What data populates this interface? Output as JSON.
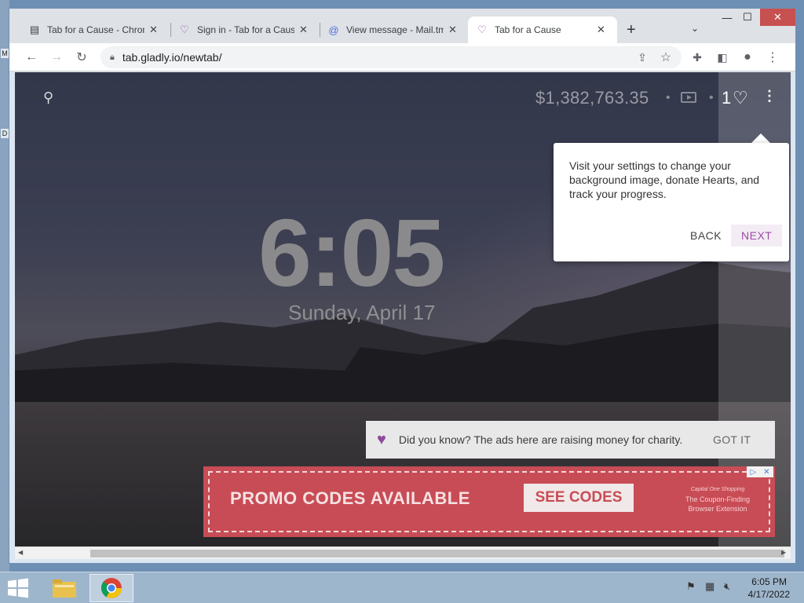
{
  "desktop": {
    "glyphs": [
      "M",
      "D"
    ]
  },
  "browser": {
    "tabs": [
      {
        "title": "Tab for a Cause - Chrom",
        "close": "✕"
      },
      {
        "title": "Sign in - Tab for a Caus",
        "close": "✕"
      },
      {
        "title": "View message - Mail.tm",
        "close": "✕"
      },
      {
        "title": "Tab for a Cause",
        "close": "✕"
      }
    ],
    "active_tab_index": 3,
    "new_tab_label": "+",
    "url": "tab.gladly.io/newtab/",
    "window_buttons": {
      "minimize": "—",
      "maximize": "☐",
      "close": "✕"
    }
  },
  "page": {
    "money_raised": "$1,382,763.35",
    "hearts": "1",
    "clock": "6:05",
    "date": "Sunday, April 17",
    "tooltip": {
      "text": "Visit your settings to change your background image, donate Hearts, and track your progress.",
      "back_label": "BACK",
      "next_label": "NEXT"
    },
    "notice": {
      "text": "Did you know? The ads here are raising money for charity.",
      "action": "GOT IT"
    },
    "ad": {
      "headline": "PROMO CODES AVAILABLE",
      "cta": "SEE CODES",
      "brand_line": "Capital One Shopping",
      "tagline": "The Coupon-Finding Browser Extension"
    },
    "colors": {
      "accent_purple": "#9d4ba3",
      "ad_red": "#c84c55"
    }
  },
  "taskbar": {
    "time": "6:05 PM",
    "date": "4/17/2022"
  }
}
